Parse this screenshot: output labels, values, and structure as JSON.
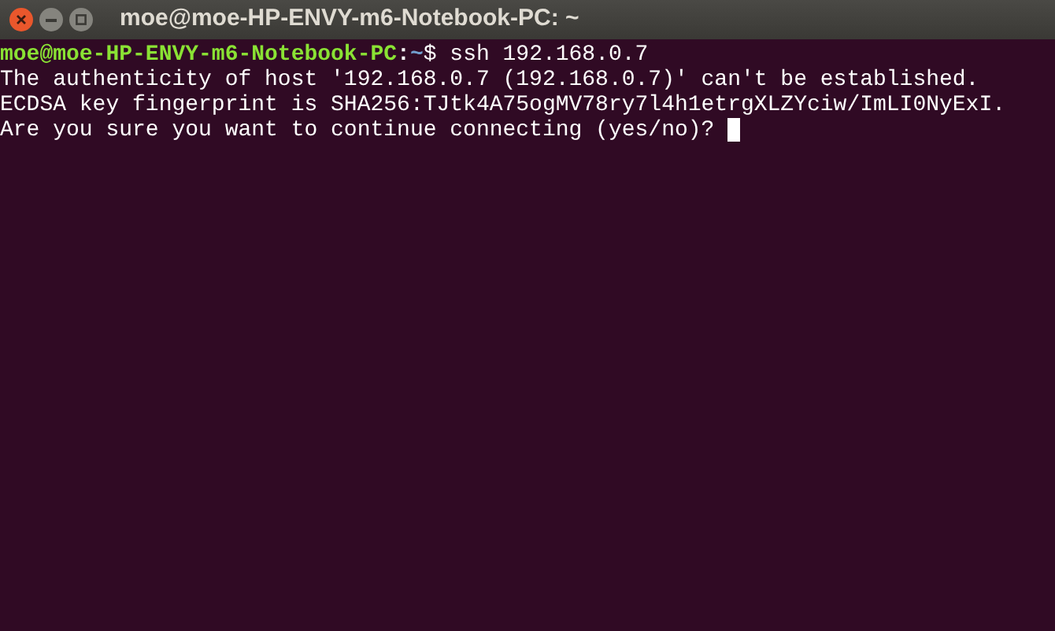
{
  "window": {
    "title": "moe@moe-HP-ENVY-m6-Notebook-PC: ~"
  },
  "terminal": {
    "lines": [
      {
        "kind": "prompt",
        "user_host": "moe@moe-HP-ENVY-m6-Notebook-PC",
        "separator": ":",
        "path": "~",
        "symbol": "$",
        "command": "ssh 192.168.0.7",
        "cursor": false
      },
      {
        "kind": "output",
        "text": "The authenticity of host '192.168.0.7 (192.168.0.7)' can't be established.",
        "cursor": false
      },
      {
        "kind": "output",
        "text": "ECDSA key fingerprint is SHA256:TJtk4A75ogMV78ry7l4h1etrgXLZYciw/ImLI0NyExI.",
        "cursor": false
      },
      {
        "kind": "output",
        "text": "Are you sure you want to continue connecting (yes/no)?",
        "cursor": true
      }
    ]
  }
}
